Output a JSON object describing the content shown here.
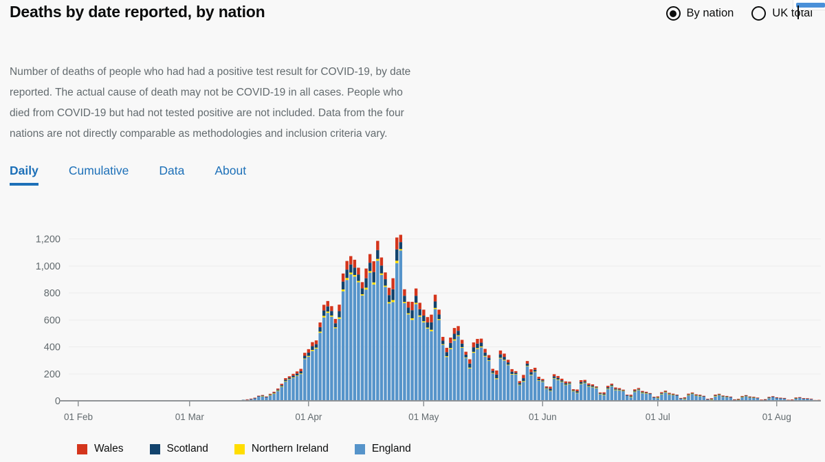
{
  "header": {
    "title": "Deaths by date reported, by nation",
    "toggle": {
      "options": [
        {
          "label": "By nation",
          "selected": true
        },
        {
          "label": "UK total",
          "selected": false
        }
      ]
    }
  },
  "description": "Number of deaths of people who had had a positive test result for COVID-19, by date reported. The actual cause of death may not be COVID-19 in all cases. People who died from COVID-19 but had not tested positive are not included. Data from the four nations are not directly comparable as methodologies and inclusion criteria vary.",
  "tabs": [
    {
      "label": "Daily",
      "active": true
    },
    {
      "label": "Cumulative",
      "active": false
    },
    {
      "label": "Data",
      "active": false
    },
    {
      "label": "About",
      "active": false
    }
  ],
  "colors": {
    "wales": "#d4351c",
    "scotland": "#12436d",
    "northern_ireland": "#ffdd00",
    "england": "#5694ca",
    "accent_link": "#1d70b8",
    "text_muted": "#626a6e",
    "text_dark": "#0b0c0c",
    "background": "#f8f8f8",
    "gridline": "#ededed",
    "axis": "#8f9396"
  },
  "chart_data": {
    "type": "bar",
    "stacked": true,
    "title": "Deaths by date reported, by nation",
    "xlabel": "",
    "ylabel": "",
    "ylim": [
      0,
      1300
    ],
    "yticks": [
      0,
      200,
      400,
      600,
      800,
      1000,
      1200
    ],
    "ytick_labels": [
      "0",
      "200",
      "400",
      "600",
      "800",
      "1,000",
      "1,200"
    ],
    "grid": true,
    "legend_position": "bottom",
    "x_start": "2020-01-30",
    "x_end": "2020-08-12",
    "xtick_labels": [
      "01 Feb",
      "01 Mar",
      "01 Apr",
      "01 May",
      "01 Jun",
      "01 Jul",
      "01 Aug"
    ],
    "xtick_dates": [
      "2020-02-01",
      "2020-03-01",
      "2020-04-01",
      "2020-05-01",
      "2020-06-01",
      "2020-07-01",
      "2020-08-01"
    ],
    "series": [
      {
        "name": "England",
        "color": "#5694ca",
        "values": [
          0,
          0,
          0,
          0,
          0,
          0,
          0,
          0,
          0,
          0,
          0,
          0,
          0,
          0,
          0,
          0,
          0,
          0,
          0,
          0,
          0,
          0,
          0,
          0,
          0,
          0,
          0,
          0,
          0,
          0,
          0,
          0,
          0,
          0,
          0,
          0,
          0,
          0,
          0,
          1,
          0,
          1,
          2,
          1,
          4,
          6,
          10,
          14,
          20,
          33,
          35,
          27,
          42,
          54,
          75,
          107,
          143,
          160,
          170,
          185,
          198,
          310,
          327,
          369,
          387,
          504,
          618,
          652,
          624,
          538,
          608,
          812,
          896,
          938,
          921,
          879,
          781,
          825,
          950,
          862,
          1039,
          934,
          845,
          722,
          732,
          1021,
          1115,
          724,
          641,
          600,
          717,
          624,
          582,
          536,
          516,
          680,
          599,
          415,
          325,
          383,
          447,
          479,
          393,
          318,
          240,
          356,
          384,
          397,
          328,
          297,
          204,
          161,
          314,
          299,
          264,
          195,
          196,
          118,
          141,
          255,
          190,
          214,
          149,
          142,
          92,
          72,
          166,
          155,
          140,
          118,
          127,
          73,
          58,
          125,
          133,
          107,
          102,
          96,
          51,
          43,
          89,
          110,
          82,
          79,
          74,
          39,
          30,
          68,
          82,
          60,
          56,
          52,
          25,
          22,
          51,
          64,
          48,
          44,
          41,
          18,
          15,
          42,
          53,
          39,
          36,
          34,
          12,
          10,
          35,
          44,
          32,
          30,
          28,
          9,
          8,
          28,
          36,
          26,
          24,
          22,
          7,
          6,
          22,
          29,
          21,
          20,
          18,
          6,
          5,
          18,
          24,
          17,
          16,
          15,
          5,
          4,
          15,
          20,
          14,
          13,
          12
        ]
      },
      {
        "name": "Northern Ireland",
        "color": "#ffdd00",
        "values": [
          0,
          0,
          0,
          0,
          0,
          0,
          0,
          0,
          0,
          0,
          0,
          0,
          0,
          0,
          0,
          0,
          0,
          0,
          0,
          0,
          0,
          0,
          0,
          0,
          0,
          0,
          0,
          0,
          0,
          0,
          0,
          0,
          0,
          0,
          0,
          0,
          0,
          0,
          0,
          0,
          0,
          0,
          0,
          0,
          0,
          0,
          0,
          0,
          0,
          0,
          1,
          0,
          1,
          1,
          2,
          1,
          3,
          2,
          4,
          3,
          5,
          4,
          6,
          8,
          7,
          9,
          12,
          10,
          8,
          7,
          11,
          14,
          15,
          13,
          12,
          10,
          9,
          14,
          12,
          16,
          13,
          11,
          9,
          10,
          15,
          18,
          10,
          9,
          8,
          12,
          10,
          9,
          8,
          7,
          11,
          9,
          7,
          5,
          6,
          8,
          9,
          7,
          5,
          4,
          6,
          7,
          7,
          6,
          5,
          4,
          3,
          6,
          5,
          5,
          4,
          4,
          2,
          2,
          5,
          4,
          4,
          3,
          3,
          2,
          1,
          3,
          3,
          3,
          2,
          2,
          1,
          1,
          2,
          2,
          2,
          2,
          2,
          1,
          1,
          2,
          2,
          1,
          1,
          1,
          1,
          0,
          1,
          1,
          1,
          1,
          1,
          0,
          0,
          1,
          1,
          1,
          1,
          1,
          0,
          0,
          1,
          1,
          1,
          1,
          1,
          0,
          0,
          1,
          1,
          1,
          1,
          1,
          0,
          0,
          1,
          1,
          1,
          1,
          1,
          0,
          0,
          1,
          1,
          0,
          0,
          0,
          0,
          0,
          0,
          1,
          0,
          0,
          0,
          0,
          0,
          0,
          1,
          0,
          0,
          0
        ]
      },
      {
        "name": "Scotland",
        "color": "#12436d",
        "values": [
          0,
          0,
          0,
          0,
          0,
          0,
          0,
          0,
          0,
          0,
          0,
          0,
          0,
          0,
          0,
          0,
          0,
          0,
          0,
          0,
          0,
          0,
          0,
          0,
          0,
          0,
          0,
          0,
          0,
          0,
          0,
          0,
          0,
          0,
          0,
          0,
          0,
          0,
          0,
          0,
          0,
          0,
          0,
          0,
          0,
          1,
          0,
          1,
          1,
          2,
          3,
          2,
          4,
          5,
          6,
          8,
          10,
          9,
          12,
          14,
          16,
          20,
          24,
          28,
          26,
          33,
          40,
          38,
          34,
          30,
          46,
          58,
          62,
          60,
          55,
          48,
          44,
          70,
          62,
          77,
          66,
          58,
          48,
          52,
          80,
          84,
          52,
          46,
          42,
          60,
          52,
          46,
          42,
          38,
          55,
          48,
          34,
          26,
          30,
          38,
          41,
          33,
          26,
          20,
          30,
          34,
          33,
          28,
          25,
          18,
          14,
          28,
          26,
          22,
          17,
          17,
          10,
          12,
          22,
          17,
          19,
          13,
          12,
          8,
          6,
          14,
          13,
          12,
          10,
          11,
          6,
          5,
          11,
          12,
          9,
          9,
          8,
          4,
          4,
          8,
          9,
          7,
          7,
          6,
          3,
          3,
          6,
          7,
          5,
          5,
          4,
          2,
          2,
          4,
          5,
          4,
          4,
          3,
          2,
          1,
          4,
          4,
          3,
          3,
          3,
          1,
          1,
          3,
          4,
          3,
          2,
          2,
          1,
          1,
          2,
          3,
          2,
          2,
          2,
          1,
          1,
          2,
          2,
          2,
          2,
          1,
          1,
          1,
          2,
          2,
          1,
          1,
          1,
          0,
          0,
          1,
          2,
          1,
          1,
          1
        ]
      },
      {
        "name": "Wales",
        "color": "#d4351c",
        "values": [
          0,
          0,
          0,
          0,
          0,
          0,
          0,
          0,
          0,
          0,
          0,
          0,
          0,
          0,
          0,
          0,
          0,
          0,
          0,
          0,
          0,
          0,
          0,
          0,
          0,
          0,
          0,
          0,
          0,
          0,
          0,
          0,
          0,
          0,
          0,
          0,
          0,
          0,
          0,
          0,
          0,
          0,
          0,
          0,
          1,
          0,
          1,
          1,
          2,
          3,
          4,
          3,
          5,
          7,
          8,
          10,
          12,
          11,
          14,
          16,
          18,
          22,
          26,
          30,
          28,
          35,
          42,
          40,
          36,
          32,
          48,
          60,
          64,
          62,
          58,
          50,
          46,
          72,
          64,
          80,
          68,
          60,
          50,
          54,
          82,
          88,
          54,
          48,
          44,
          62,
          54,
          48,
          44,
          40,
          57,
          50,
          36,
          28,
          32,
          40,
          43,
          35,
          28,
          22,
          32,
          36,
          35,
          30,
          27,
          20,
          16,
          30,
          28,
          24,
          19,
          19,
          12,
          14,
          24,
          19,
          21,
          15,
          14,
          10,
          8,
          16,
          15,
          14,
          12,
          13,
          8,
          7,
          13,
          14,
          11,
          11,
          10,
          6,
          6,
          10,
          11,
          9,
          9,
          8,
          5,
          4,
          8,
          9,
          7,
          7,
          6,
          3,
          3,
          6,
          7,
          6,
          6,
          5,
          3,
          2,
          6,
          6,
          5,
          5,
          5,
          2,
          2,
          5,
          6,
          4,
          4,
          3,
          2,
          1,
          4,
          4,
          3,
          3,
          3,
          1,
          1,
          3,
          4,
          3,
          3,
          2,
          2,
          1,
          3,
          4,
          2,
          2,
          2,
          1,
          1,
          2,
          3,
          2,
          2,
          2
        ]
      }
    ]
  },
  "legend": [
    {
      "label": "Wales",
      "color": "#d4351c"
    },
    {
      "label": "Scotland",
      "color": "#12436d"
    },
    {
      "label": "Northern Ireland",
      "color": "#ffdd00"
    },
    {
      "label": "England",
      "color": "#5694ca"
    }
  ]
}
